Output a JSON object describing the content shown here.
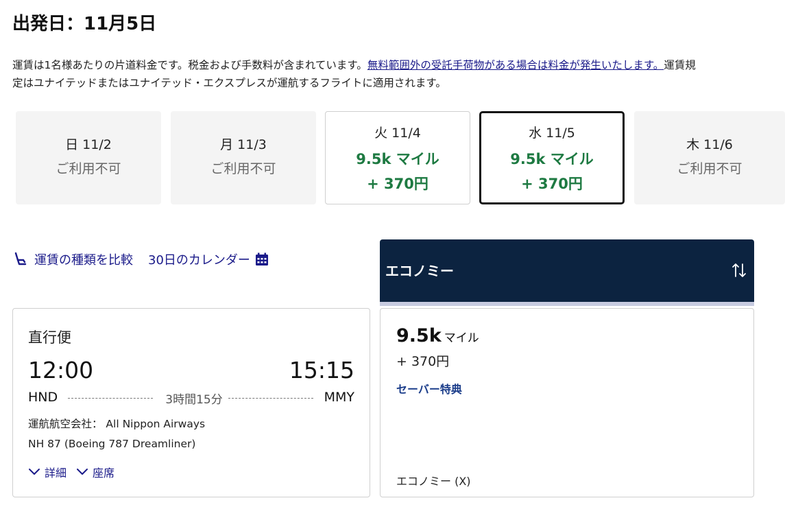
{
  "header": {
    "title": "出発日：11月5日"
  },
  "notice": {
    "text_before": "運賃は1名様あたりの片道料金です。税金および手数料が含まれています。",
    "link_text": "無料範囲外の受託手荷物がある場合は料金が発生いたします。",
    "text_after": "運賃規定はユナイテッドまたはユナイテッド・エクスプレスが運航するフライトに適用されます。"
  },
  "dates": [
    {
      "day": "日 11/2",
      "status": "ご利用不可"
    },
    {
      "day": "月 11/3",
      "status": "ご利用不可"
    },
    {
      "day": "火 11/4",
      "miles": "9.5k マイル",
      "yen": "+ 370円"
    },
    {
      "day": "水 11/5",
      "miles": "9.5k マイル",
      "yen": "+ 370円"
    },
    {
      "day": "木 11/6",
      "status": "ご利用不可"
    }
  ],
  "actions": {
    "compare_label": "運賃の種類を比較",
    "calendar_label": "30日のカレンダー"
  },
  "cabin": {
    "label": "エコノミー"
  },
  "flight": {
    "type": "直行便",
    "departure_time": "12:00",
    "arrival_time": "15:15",
    "origin": "HND",
    "destination": "MMY",
    "duration": "3時間15分",
    "operator": "運航航空会社： All Nippon Airways",
    "flight_number": "NH 87 (Boeing 787 Dreamliner)",
    "details_label": "詳細",
    "seats_label": "座席"
  },
  "fare": {
    "miles": "9.5k",
    "miles_unit": "マイル",
    "yen": "+ 370円",
    "brand": "セーバー特典",
    "cabin_class": "エコノミー (X)"
  },
  "colors": {
    "navy": "#0c2340",
    "green": "#1e7a42",
    "link": "#1b1b8a"
  }
}
